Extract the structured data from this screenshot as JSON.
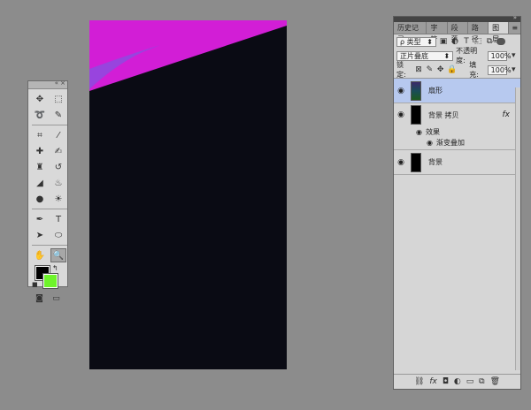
{
  "tools": {
    "items": [
      {
        "name": "move-tool-icon",
        "glyph": "✥"
      },
      {
        "name": "artboard-tool-icon",
        "glyph": "⬚"
      },
      {
        "name": "lasso-tool-icon",
        "glyph": "➰"
      },
      {
        "name": "quick-select-tool-icon",
        "glyph": "✎"
      },
      {
        "name": "crop-tool-icon",
        "glyph": "⌗"
      },
      {
        "name": "eyedropper-tool-icon",
        "glyph": "⁄"
      },
      {
        "name": "spot-heal-tool-icon",
        "glyph": "✚"
      },
      {
        "name": "brush-tool-icon",
        "glyph": "✍"
      },
      {
        "name": "clone-stamp-tool-icon",
        "glyph": "♜"
      },
      {
        "name": "history-brush-tool-icon",
        "glyph": "↺"
      },
      {
        "name": "eraser-tool-icon",
        "glyph": "◢"
      },
      {
        "name": "paint-bucket-tool-icon",
        "glyph": "♨"
      },
      {
        "name": "blur-tool-icon",
        "glyph": "●"
      },
      {
        "name": "dodge-tool-icon",
        "glyph": "☀"
      },
      {
        "name": "pen-tool-icon",
        "glyph": "✒"
      },
      {
        "name": "type-tool-icon",
        "glyph": "T"
      },
      {
        "name": "path-select-tool-icon",
        "glyph": "➤"
      },
      {
        "name": "shape-tool-icon",
        "glyph": "⬭"
      },
      {
        "name": "hand-tool-icon",
        "glyph": "✋"
      },
      {
        "name": "zoom-tool-icon",
        "glyph": "🔍"
      }
    ],
    "foreground_color": "#000000",
    "background_color": "#6ef42a"
  },
  "panel": {
    "tabs": [
      "历史记录",
      "字符",
      "段落",
      "路径",
      "图层"
    ],
    "active_tab": "图层",
    "filter_label": "ρ 类型",
    "blend_mode": "正片叠底",
    "opacity_label": "不透明度:",
    "opacity_value": "100%",
    "lock_label": "锁定:",
    "fill_label": "填充:",
    "fill_value": "100%",
    "layers": [
      {
        "name": "扇形",
        "selected": true
      },
      {
        "name": "背景 拷贝",
        "selected": false,
        "fx": "fx"
      },
      {
        "name": "背景",
        "selected": false
      }
    ],
    "effects_label": "效果",
    "gradient_overlay_label": "渐变叠加"
  },
  "colors": {
    "canvas_top": "#d21ed6",
    "canvas_bottom": "#123d0c",
    "panel_selected": "#b7c9ef"
  }
}
